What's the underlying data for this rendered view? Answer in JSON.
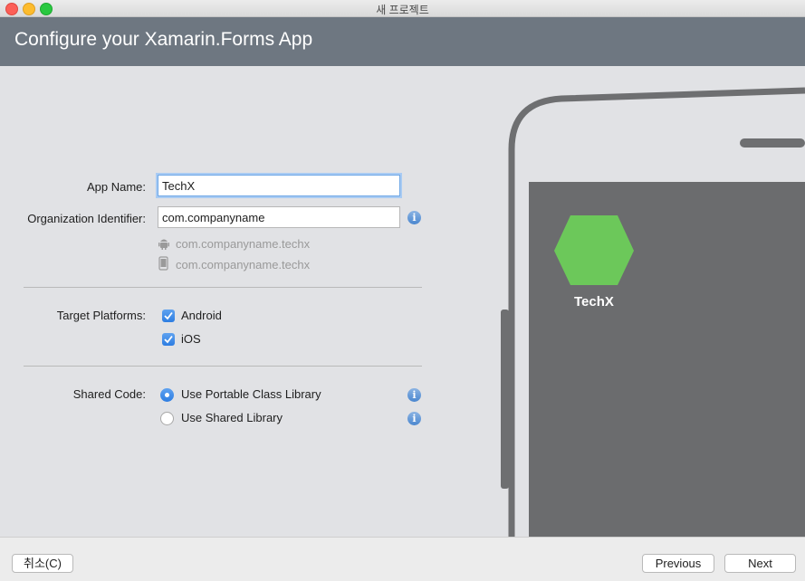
{
  "window": {
    "title": "새 프로젝트"
  },
  "header": {
    "title": "Configure your Xamarin.Forms App"
  },
  "form": {
    "app_name": {
      "label": "App Name:",
      "value": "TechX"
    },
    "org_id": {
      "label": "Organization Identifier:",
      "value": "com.companyname"
    },
    "bundle_ids": {
      "android": "com.companyname.techx",
      "ios": "com.companyname.techx"
    },
    "platforms": {
      "label": "Target Platforms:",
      "items": [
        {
          "label": "Android",
          "checked": true
        },
        {
          "label": "iOS",
          "checked": true
        }
      ]
    },
    "shared_code": {
      "label": "Shared Code:",
      "options": [
        {
          "label": "Use Portable Class Library",
          "selected": true
        },
        {
          "label": "Use Shared Library",
          "selected": false
        }
      ]
    }
  },
  "preview": {
    "app_label": "TechX",
    "icon_color": "#6cc85a"
  },
  "footer": {
    "cancel_label": "취소(C)",
    "previous_label": "Previous",
    "next_label": "Next"
  },
  "colors": {
    "header": "#6e7781",
    "accent": "#2d7de2",
    "phone_screen": "#6b6c6e"
  }
}
